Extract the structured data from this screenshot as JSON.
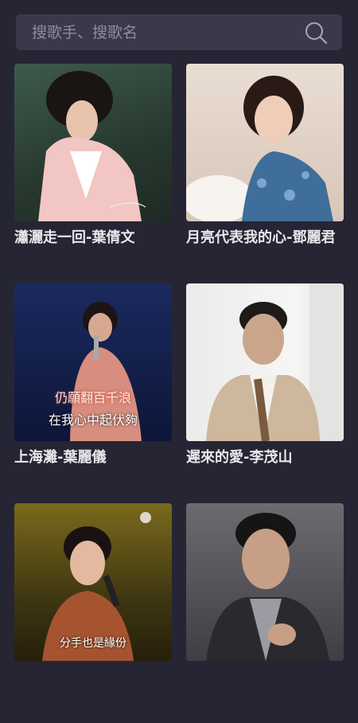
{
  "search": {
    "placeholder": "搜歌手、搜歌名"
  },
  "songs": [
    {
      "title": "瀟灑走一回-葉倩文"
    },
    {
      "title": "月亮代表我的心-鄧麗君"
    },
    {
      "title": "上海灘-葉麗儀",
      "subtitle_line1": "仍願翻百千浪",
      "subtitle_line2": "在我心中起伏夠"
    },
    {
      "title": "遲來的愛-李茂山"
    },
    {
      "title": "",
      "subtitle_line1": "分手也是緣份"
    },
    {
      "title": ""
    }
  ]
}
